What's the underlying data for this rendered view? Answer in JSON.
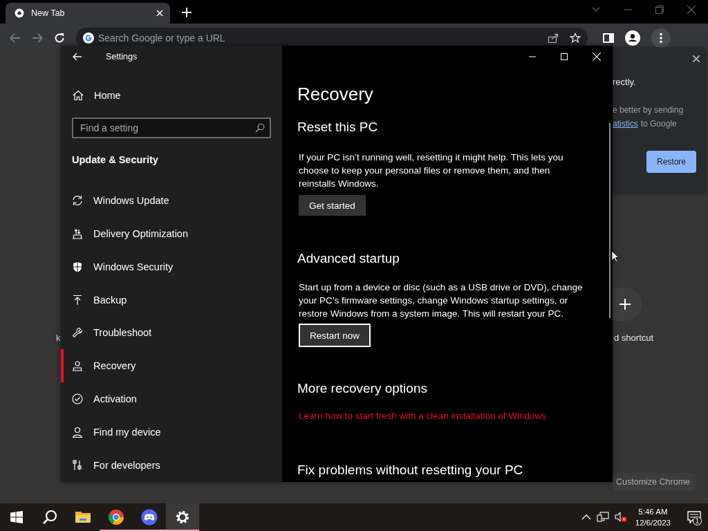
{
  "browser": {
    "tab": {
      "title": "New Tab"
    },
    "omnibox": {
      "placeholder": "Search Google or type a URL"
    },
    "restore_popup": {
      "lines": [
        "rectly.",
        "e better by sending"
      ],
      "link": "atistics",
      "link_tail": "to Google",
      "button": "Restore"
    },
    "page": {
      "left_fragment": "k",
      "add_shortcut_label": "d shortcut",
      "customize_button": "Customize Chrome"
    }
  },
  "settings": {
    "title": "Settings",
    "home": "Home",
    "search": {
      "placeholder": "Find a setting"
    },
    "section": "Update & Security",
    "nav": [
      {
        "label": "Windows Update",
        "selected": false
      },
      {
        "label": "Delivery Optimization",
        "selected": false
      },
      {
        "label": "Windows Security",
        "selected": false
      },
      {
        "label": "Backup",
        "selected": false
      },
      {
        "label": "Troubleshoot",
        "selected": false
      },
      {
        "label": "Recovery",
        "selected": true
      },
      {
        "label": "Activation",
        "selected": false
      },
      {
        "label": "Find my device",
        "selected": false
      },
      {
        "label": "For developers",
        "selected": false
      }
    ],
    "heading": "Recovery",
    "sections": [
      {
        "title": "Reset this PC",
        "text": "If your PC isn’t running well, resetting it might help. This lets you choose to keep your personal files or remove them, and then reinstalls Windows.",
        "button": {
          "label": "Get started",
          "focused": false
        }
      },
      {
        "title": "Advanced startup",
        "text": "Start up from a device or disc (such as a USB drive or DVD), change your PC’s firmware settings, change Windows startup settings, or restore Windows from a system image. This will restart your PC.",
        "button": {
          "label": "Restart now",
          "focused": true
        }
      },
      {
        "title": "More recovery options",
        "link": "Learn how to start fresh with a clean installation of Windows"
      },
      {
        "title": "Fix problems without resetting your PC"
      }
    ]
  },
  "taskbar": {
    "apps": [
      {
        "running": false,
        "selected": false
      },
      {
        "running": true,
        "selected": false
      },
      {
        "running": true,
        "selected": false
      },
      {
        "running": true,
        "selected": true
      }
    ],
    "time": "5:46 AM",
    "date": "12/6/2023",
    "notification_count": "1"
  }
}
